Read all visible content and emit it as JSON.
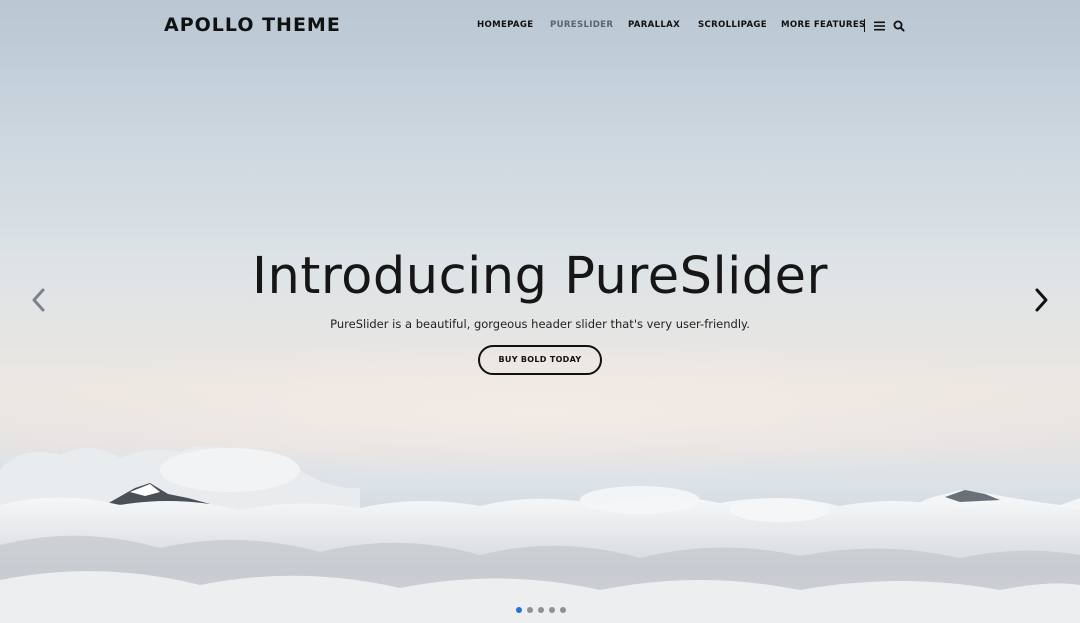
{
  "brand": {
    "name": "APOLLO THEME"
  },
  "nav": {
    "items": [
      {
        "label": "HOMEPAGE",
        "active": false
      },
      {
        "label": "PURESLIDER",
        "active": true
      },
      {
        "label": "PARALLAX",
        "active": false
      },
      {
        "label": "SCROLLIPAGE",
        "active": false
      },
      {
        "label": "MORE FEATURES",
        "active": false
      }
    ],
    "menu_icon": "hamburger-menu-icon",
    "search_icon": "search-icon"
  },
  "slider": {
    "title": "Introducing PureSlider",
    "subtitle": "PureSlider is a beautiful, gorgeous header slider that's very user-friendly.",
    "cta_label": "BUY BOLD TODAY",
    "prev_icon": "chevron-left-icon",
    "next_icon": "chevron-right-icon",
    "slide_count": 5,
    "active_slide": 1,
    "colors": {
      "active_dot": "#2d6fd1",
      "inactive_dot": "#8c9196",
      "prev_arrow": "#7d8288",
      "next_arrow": "#111111"
    }
  }
}
